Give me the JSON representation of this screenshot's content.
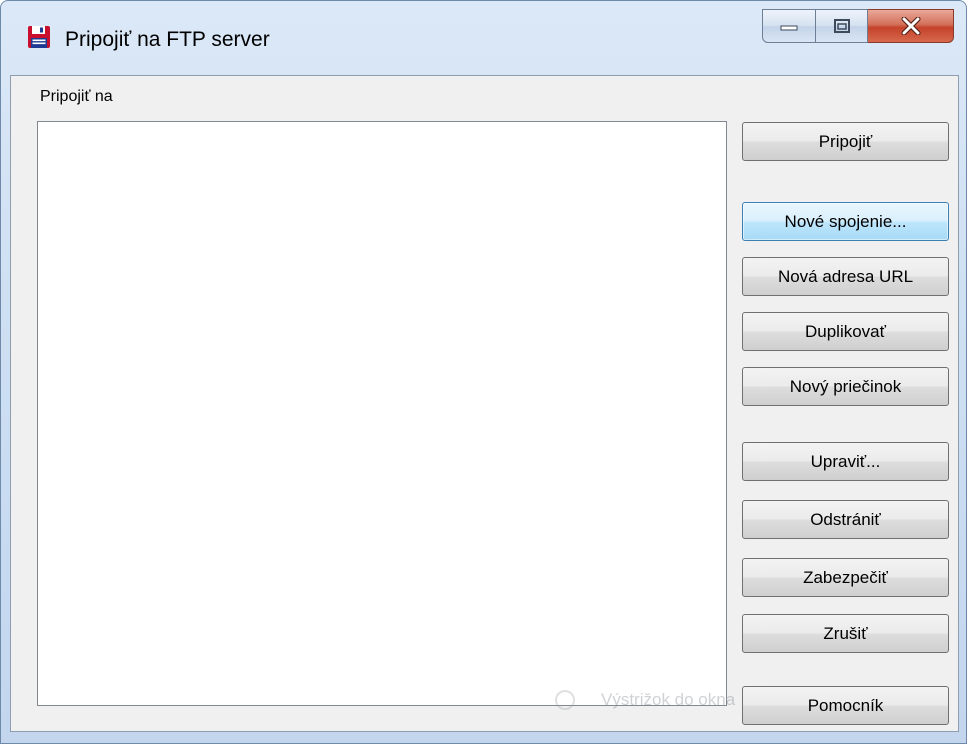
{
  "window": {
    "title": "Pripojiť na FTP server",
    "icon": "floppy-disk-icon"
  },
  "caption_buttons": {
    "minimize_icon": "minimize-icon",
    "maximize_icon": "maximize-icon",
    "close_icon": "close-icon"
  },
  "dialog": {
    "group_label": "Pripojiť na",
    "list_items": [],
    "buttons": {
      "connect": "Pripojiť",
      "new_connection": "Nové spojenie...",
      "new_url": "Nová adresa URL",
      "duplicate": "Duplikovať",
      "new_folder": "Nový priečinok",
      "edit": "Upraviť...",
      "delete": "Odstrániť",
      "secure": "Zabezpečiť",
      "cancel": "Zrušiť",
      "help": "Pomocník"
    },
    "default_button": "new_connection"
  },
  "overlay": {
    "snip_tooltip": "Výstrižok do okna",
    "icon": "snipping-tool-icon"
  },
  "colors": {
    "titlebar": "#cfe0f3",
    "client_bg": "#f0f0f0",
    "close_button": "#c4432a",
    "default_button_border": "#3c7fb1"
  }
}
